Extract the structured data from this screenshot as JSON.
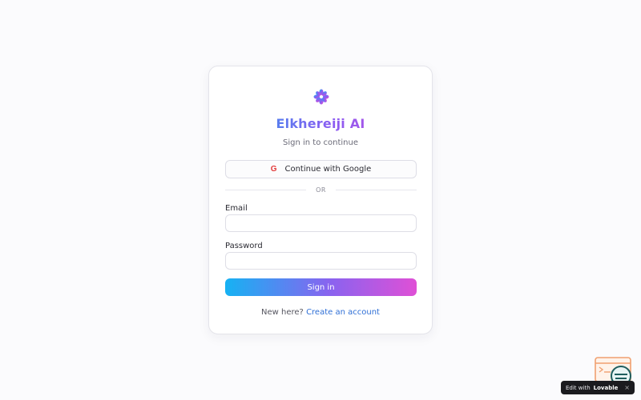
{
  "app": {
    "title": "Elkhereiji AI",
    "subtitle": "Sign in to continue"
  },
  "google": {
    "icon_letter": "G",
    "label": "Continue with Google"
  },
  "divider": {
    "text": "OR"
  },
  "form": {
    "email_label": "Email",
    "email_value": "",
    "password_label": "Password",
    "password_value": "",
    "submit_label": "Sign in"
  },
  "signup": {
    "prompt": "New here?",
    "link": "Create an account"
  },
  "badge": {
    "prefix": "Edit with",
    "brand": "Lovable",
    "close": "×"
  },
  "colors": {
    "accent_start": "#16b2f3",
    "accent_mid": "#8a63ef",
    "accent_end": "#df50d6",
    "link": "#2f6fd6",
    "google_icon": "#e23a3a"
  },
  "icons": {
    "logo": "flower-logo-icon",
    "google": "google-g-icon",
    "floating": "chat-widget-icon"
  }
}
